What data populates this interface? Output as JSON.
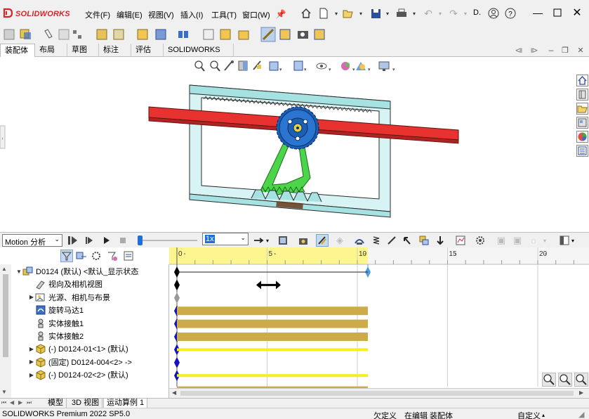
{
  "app": {
    "brand_ds": "3S",
    "brand_name": "SOLIDWORKS",
    "menus": [
      "文件(F)",
      "编辑(E)",
      "视图(V)",
      "插入(I)",
      "工具(T)",
      "窗口(W)"
    ],
    "title_fragment": "D.",
    "colors": {
      "accent": "#d4282b",
      "rack": "#e8322f",
      "frame": "#a6e2e2",
      "gear": "#1a5fb4",
      "link": "#4cd44a",
      "timebar": "#cdaa4a",
      "timebar_hi": "#f7ef1a",
      "key": "#1212c4",
      "timeline_head": "#fdf58e"
    }
  },
  "tabs": [
    "装配体",
    "布局",
    "草图",
    "标注",
    "评估",
    "SOLIDWORKS 插件"
  ],
  "motion": {
    "study_type": "Motion 分析",
    "speed": "1x",
    "ruler_labels": [
      "0",
      "5",
      "10",
      "15",
      "20"
    ],
    "tree": [
      {
        "label": "D0124 (默认) <默认_显示状态",
        "expand": "▼",
        "icon": "assembly-icon",
        "indent": 0
      },
      {
        "label": "视向及相机视图",
        "expand": "",
        "icon": "camera-icon",
        "indent": 1
      },
      {
        "label": "光源、相机与布景",
        "expand": "▶",
        "icon": "lights-icon",
        "indent": 1
      },
      {
        "label": "旋转马达1",
        "expand": "",
        "icon": "motor-icon",
        "indent": 1
      },
      {
        "label": "实体接触1",
        "expand": "",
        "icon": "contact-icon",
        "indent": 1
      },
      {
        "label": "实体接触2",
        "expand": "",
        "icon": "contact-icon",
        "indent": 1
      },
      {
        "label": "(-) D0124-01<1> (默认)",
        "expand": "▶",
        "icon": "part-icon",
        "indent": 1
      },
      {
        "label": "(固定) D0124-004<2> ->",
        "expand": "▶",
        "icon": "part-icon",
        "indent": 1
      },
      {
        "label": "(-) D0124-02<2> (默认)",
        "expand": "▶",
        "icon": "part-icon",
        "indent": 1
      }
    ]
  },
  "bottom_tabs": [
    "模型",
    "3D 视图",
    "运动算例 1"
  ],
  "status": {
    "product": "SOLIDWORKS Premium 2022 SP5.0",
    "undefined": "欠定义",
    "editing": "在编辑 装配体",
    "custom": "自定义"
  }
}
